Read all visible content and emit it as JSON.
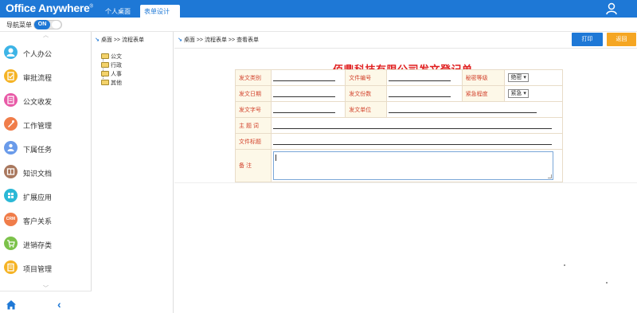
{
  "app": {
    "brand": "Office Anywhere",
    "brand_mark": "®"
  },
  "tabs": {
    "home": "个人桌面",
    "active": "表单设计",
    "active_close": "×"
  },
  "nav_toggle": {
    "label": "导航菜单",
    "state": "ON"
  },
  "sidebar": {
    "scroll_up": "︿",
    "scroll_down": "﹀",
    "items": [
      {
        "label": "个人办公",
        "icon": "person-icon",
        "color": "#3db4e6",
        "glyph": ""
      },
      {
        "label": "审批流程",
        "icon": "approval-icon",
        "color": "#f5b324",
        "glyph": ""
      },
      {
        "label": "公文收发",
        "icon": "document-icon",
        "color": "#e85aa7",
        "glyph": ""
      },
      {
        "label": "工作管理",
        "icon": "work-icon",
        "color": "#f07d4a",
        "glyph": ""
      },
      {
        "label": "下属任务",
        "icon": "team-icon",
        "color": "#6a9bea",
        "glyph": ""
      },
      {
        "label": "知识文档",
        "icon": "book-icon",
        "color": "#a9785e",
        "glyph": ""
      },
      {
        "label": "扩展应用",
        "icon": "apps-icon",
        "color": "#2bb8d6",
        "glyph": ""
      },
      {
        "label": "客户关系",
        "icon": "crm-icon",
        "color": "#f07d4a",
        "glyph": "CRM"
      },
      {
        "label": "进销存类",
        "icon": "cart-icon",
        "color": "#7cc24a",
        "glyph": ""
      },
      {
        "label": "项目管理",
        "icon": "project-icon",
        "color": "#f5b324",
        "glyph": ""
      }
    ],
    "collapse_glyph": "‹"
  },
  "tree": {
    "breadcrumb": {
      "home": "桌面",
      "sep": ">>",
      "page": "流程表单"
    },
    "folders": [
      "公文",
      "行政",
      "人事",
      "其他"
    ]
  },
  "main": {
    "breadcrumb": {
      "home": "桌面",
      "sep": ">>",
      "section": "流程表单",
      "page": "查看表单"
    },
    "print_label": "打印",
    "back_label": "返回",
    "form": {
      "title": "佰鼎科技有限公司发文登记单",
      "fields": {
        "doc_type": "发文类别",
        "doc_number": "文件编号",
        "secret_level": "秘密等级",
        "secret_value": "绝密",
        "doc_date": "发文日期",
        "doc_copies": "发文份数",
        "urgency": "紧急程度",
        "urgency_value": "紧急",
        "doc_code": "发文字号",
        "doc_unit": "发文单位",
        "subject": "主 题 词",
        "file_title": "文件标题",
        "remarks": "备    注"
      }
    }
  }
}
